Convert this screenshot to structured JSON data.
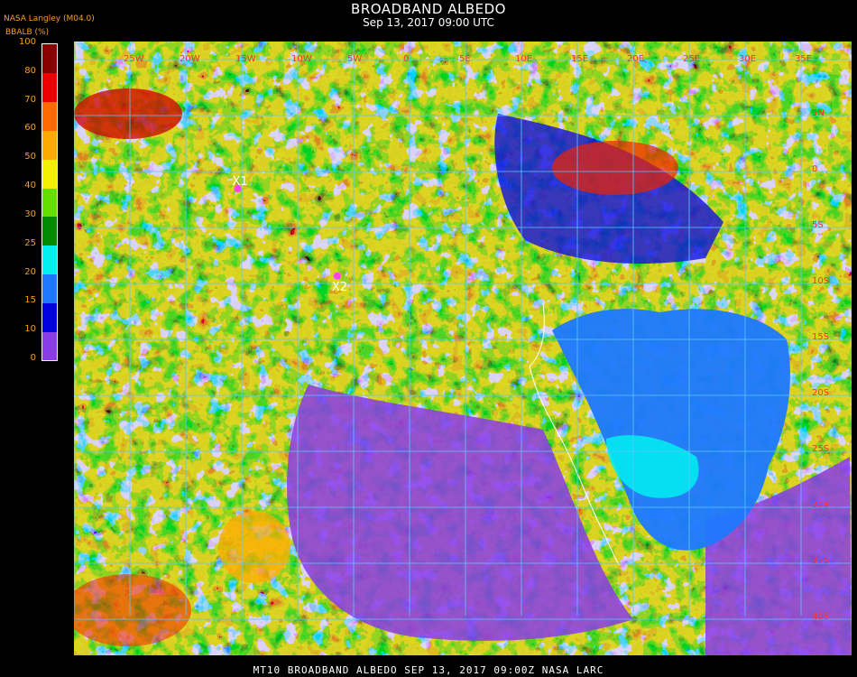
{
  "header": {
    "title": "BROADBAND ALBEDO",
    "subtitle": "Sep 13, 2017 09:00 UTC",
    "source": "NASA Langley (M04.0)",
    "unit_label": "BBALB (%)"
  },
  "colorbar": {
    "ticks": [
      "100",
      "80",
      "70",
      "60",
      "50",
      "40",
      "30",
      "25",
      "20",
      "15",
      "10",
      "0"
    ],
    "bands": [
      {
        "from": 0,
        "to": 10,
        "color": "#8a3ce8"
      },
      {
        "from": 10,
        "to": 15,
        "color": "#0000e0"
      },
      {
        "from": 15,
        "to": 20,
        "color": "#1e78ff"
      },
      {
        "from": 20,
        "to": 25,
        "color": "#00f0f0"
      },
      {
        "from": 25,
        "to": 30,
        "color": "#008a00"
      },
      {
        "from": 30,
        "to": 40,
        "color": "#64e000"
      },
      {
        "from": 40,
        "to": 50,
        "color": "#f0f000"
      },
      {
        "from": 50,
        "to": 60,
        "color": "#ffaa00"
      },
      {
        "from": 60,
        "to": 70,
        "color": "#ff6a00"
      },
      {
        "from": 70,
        "to": 80,
        "color": "#ee0000"
      },
      {
        "from": 80,
        "to": 100,
        "color": "#880000"
      }
    ]
  },
  "map": {
    "lon_labels": [
      "25W",
      "20W",
      "15W",
      "10W",
      "5W",
      "0",
      "5E",
      "10E",
      "15E",
      "20E",
      "25E",
      "30E",
      "35E"
    ],
    "lat_labels": [
      "5N",
      "0",
      "5S",
      "10S",
      "15S",
      "20S",
      "25S",
      "30S",
      "35S",
      "40S"
    ],
    "grid_color": "#5ac8ff",
    "label_color": "#ff3030",
    "markers": [
      {
        "label": "X1",
        "lon": -14.8,
        "lat": -4.6
      },
      {
        "label": "X2",
        "lon": -5.9,
        "lat": -12.4
      }
    ]
  },
  "footer": {
    "text": "MT10  BROADBAND ALBEDO  SEP 13, 2017 09:00Z  NASA LARC"
  }
}
